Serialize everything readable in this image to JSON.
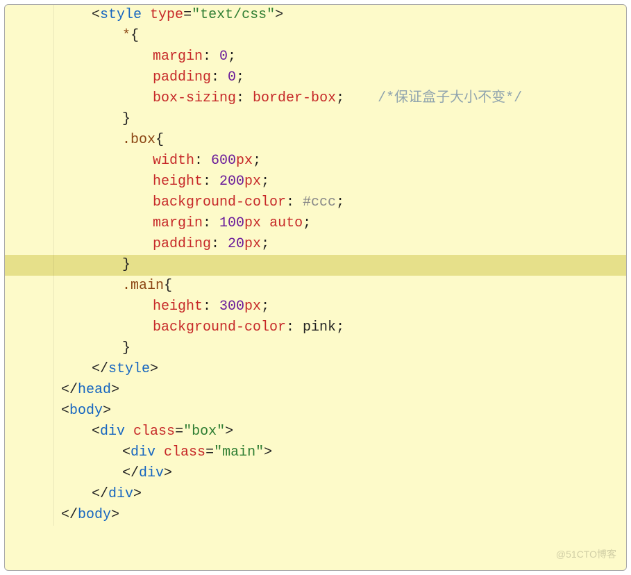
{
  "watermark": "@51CTO博客",
  "code": {
    "l1": {
      "o": "<",
      "tag": "style",
      "sp": " ",
      "attr": "type",
      "eq": "=",
      "str": "\"text/css\"",
      "c": ">"
    },
    "l2": {
      "sel": "*",
      "b": "{"
    },
    "l3": {
      "prop": "margin",
      "colon": ": ",
      "val": "0",
      "semi": ";"
    },
    "l4": {
      "prop": "padding",
      "colon": ": ",
      "val": "0",
      "semi": ";"
    },
    "l5": {
      "prop": "box-sizing",
      "colon": ": ",
      "val": "border-box",
      "semi": ";",
      "sp": "    ",
      "comment": "/*保证盒子大小不变*/"
    },
    "l6": {
      "b": "}"
    },
    "l7": {
      "sel": ".box",
      "b": "{"
    },
    "l8": {
      "prop": "width",
      "colon": ": ",
      "val": "600",
      "unit": "px",
      "semi": ";"
    },
    "l9": {
      "prop": "height",
      "colon": ": ",
      "val": "200",
      "unit": "px",
      "semi": ";"
    },
    "l10": {
      "prop": "background-color",
      "colon": ": ",
      "val": "#ccc",
      "semi": ";"
    },
    "l11": {
      "prop": "margin",
      "colon": ": ",
      "val": "100",
      "unit": "px",
      "sp": " ",
      "val2": "auto",
      "semi": ";"
    },
    "l12": {
      "prop": "padding",
      "colon": ": ",
      "val": "20",
      "unit": "px",
      "semi": ";"
    },
    "l13": {
      "b": "}"
    },
    "l14": {
      "sel": ".main",
      "b": "{"
    },
    "l15": {
      "prop": "height",
      "colon": ": ",
      "val": "300",
      "unit": "px",
      "semi": ";"
    },
    "l16": {
      "prop": "background-color",
      "colon": ": ",
      "val": "pink",
      "semi": ";"
    },
    "l17": {
      "b": "}"
    },
    "l18": {
      "o": "</",
      "tag": "style",
      "c": ">"
    },
    "l19": {
      "o": "</",
      "tag": "head",
      "c": ">"
    },
    "l20": {
      "o": "<",
      "tag": "body",
      "c": ">"
    },
    "l21": {
      "o": "<",
      "tag": "div",
      "sp": " ",
      "attr": "class",
      "eq": "=",
      "str": "\"box\"",
      "c": ">"
    },
    "l22": {
      "o": "<",
      "tag": "div",
      "sp": " ",
      "attr": "class",
      "eq": "=",
      "str": "\"main\"",
      "c": ">"
    },
    "l23": {
      "o": "</",
      "tag": "div",
      "c": ">"
    },
    "l24": {
      "o": "</",
      "tag": "div",
      "c": ">"
    },
    "l25": {
      "o": "</",
      "tag": "body",
      "c": ">"
    }
  }
}
